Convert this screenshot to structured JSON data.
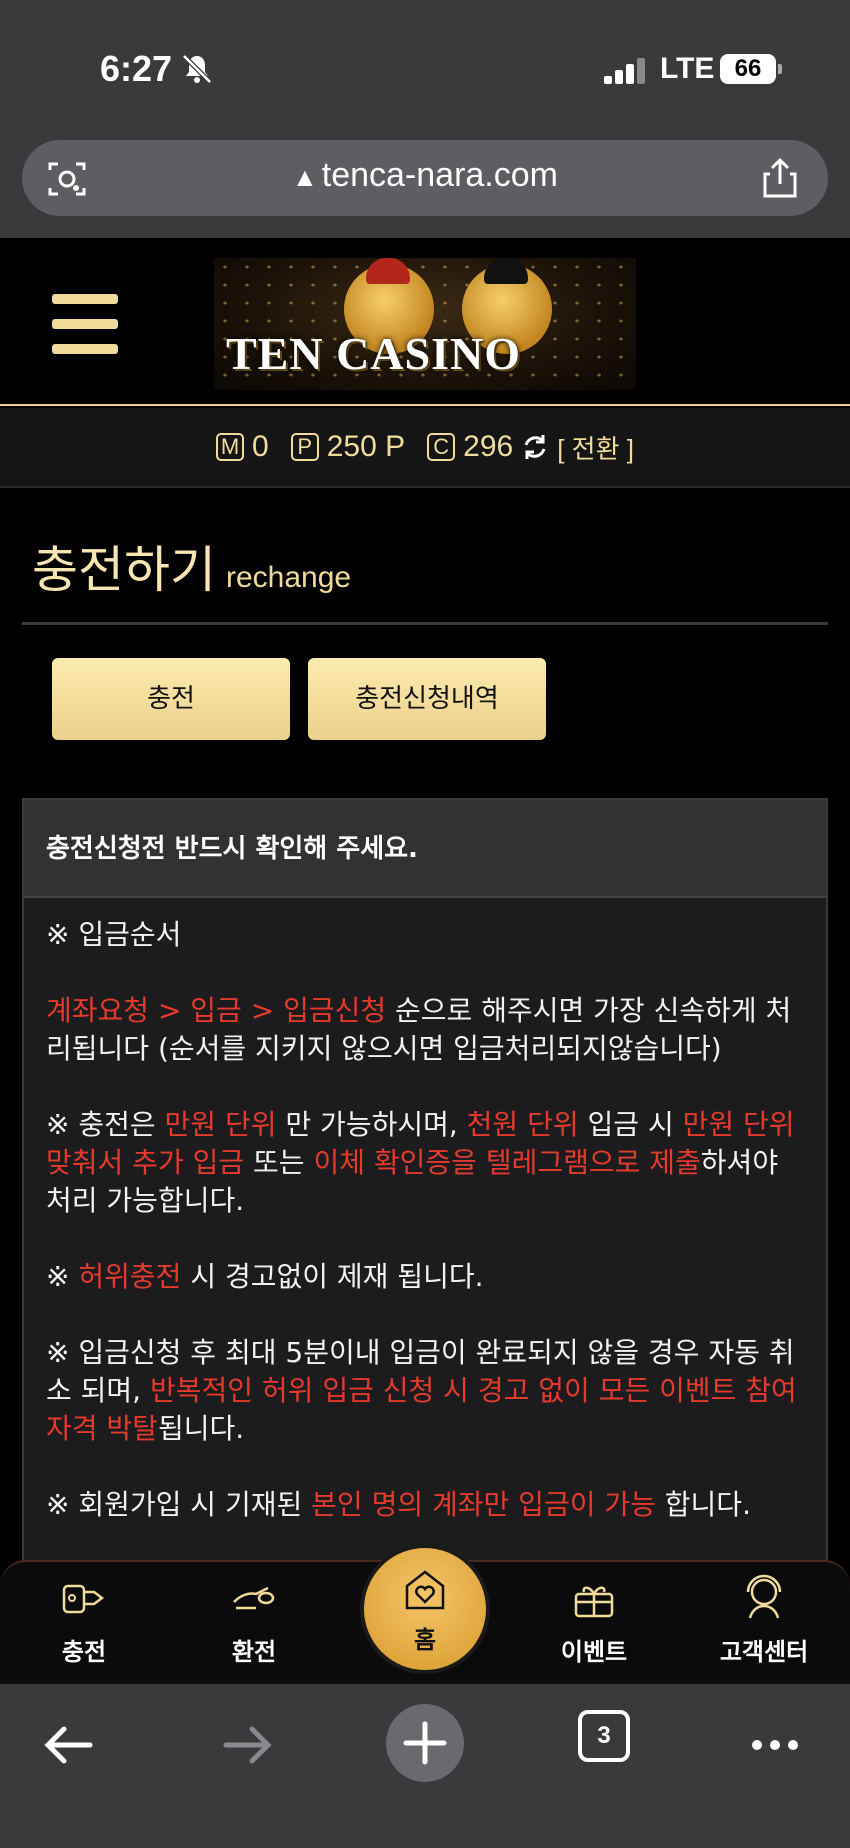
{
  "status_bar": {
    "time": "6:27",
    "network": "LTE",
    "battery": "66"
  },
  "browser": {
    "url": "tenca-nara.com",
    "tab_count": "3"
  },
  "site": {
    "logo_text": "TEN CASINO"
  },
  "balance": {
    "m_icon": "M",
    "m_value": "0",
    "p_icon": "P",
    "p_value": "250 P",
    "c_icon": "C",
    "c_value": "296",
    "convert_label": "[ 전환 ]"
  },
  "page": {
    "title": "충전하기",
    "subtitle": "rechange",
    "tabs": [
      {
        "label": "충전"
      },
      {
        "label": "충전신청내역"
      }
    ]
  },
  "notice": {
    "heading": "충전신청전 반드시 확인해 주세요.",
    "p1": "※ 입금순서",
    "p2_red": "계좌요청 > 입금 > 입금신청",
    "p2_rest": " 순으로 해주시면 가장 신속하게 처리됩니다 (순서를 지키지 않으시면 입금처리되지않습니다)",
    "p3_a": "※ 충전은 ",
    "p3_b": "만원 단위",
    "p3_c": " 만 가능하시며, ",
    "p3_d": "천원 단위",
    "p3_e": " 입금 시 ",
    "p3_f": "만원 단위 맞춰서 추가 입금",
    "p3_g": " 또는 ",
    "p3_h": "이체 확인증을 텔레그램으로 제출",
    "p3_i": "하셔야 처리 가능합니다.",
    "p4_a": "※ ",
    "p4_b": "허위충전",
    "p4_c": " 시 경고없이 제재 됩니다.",
    "p5_a": "※ 입금신청 후 최대 5분이내 입금이 완료되지 않을 경우 자동 취소 되며, ",
    "p5_b": "반복적인 허위 입금 신청 시 경고 없이 모든 이벤트 참여 자격 박탈",
    "p5_c": "됩니다.",
    "p6_a": "※ 회원가입 시 기재된 ",
    "p6_b": "본인 명의 계좌만 입금이 가능",
    "p6_c": " 합니다."
  },
  "bottom_nav": {
    "charge": "충전",
    "exchange": "환전",
    "home": "홈",
    "event": "이벤트",
    "support": "고객센터"
  },
  "colors": {
    "gold": "#f0dc9a",
    "red": "#e53a2c",
    "button": "#fbebb0"
  }
}
